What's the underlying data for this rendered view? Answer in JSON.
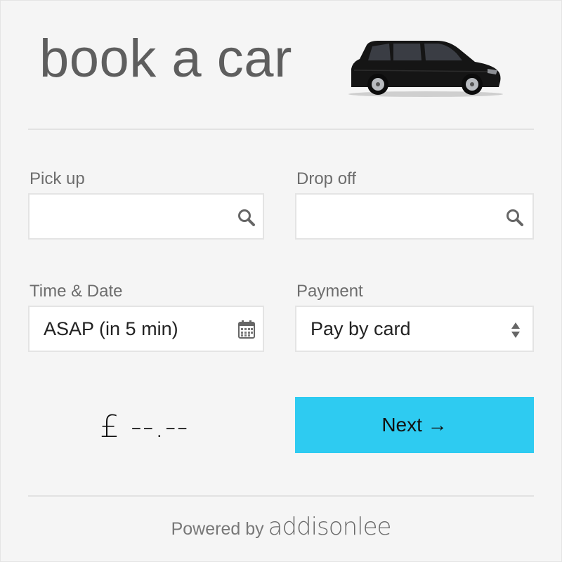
{
  "header": {
    "title": "book a car",
    "car_image": "black-mpv-car-image"
  },
  "form": {
    "pickup": {
      "label": "Pick up",
      "value": "",
      "placeholder": "",
      "icon": "search-icon"
    },
    "dropoff": {
      "label": "Drop off",
      "value": "",
      "placeholder": "",
      "icon": "search-icon"
    },
    "time_date": {
      "label": "Time & Date",
      "value": "ASAP (in 5 min)",
      "icon": "calendar-icon"
    },
    "payment": {
      "label": "Payment",
      "value": "Pay by card",
      "icon": "select-arrows-icon"
    }
  },
  "price": {
    "text": "£ --.--"
  },
  "actions": {
    "next_label": "Next →",
    "accent": "#2ecbf1"
  },
  "footer": {
    "powered_by": "Powered by",
    "brand": "addisonlee"
  }
}
